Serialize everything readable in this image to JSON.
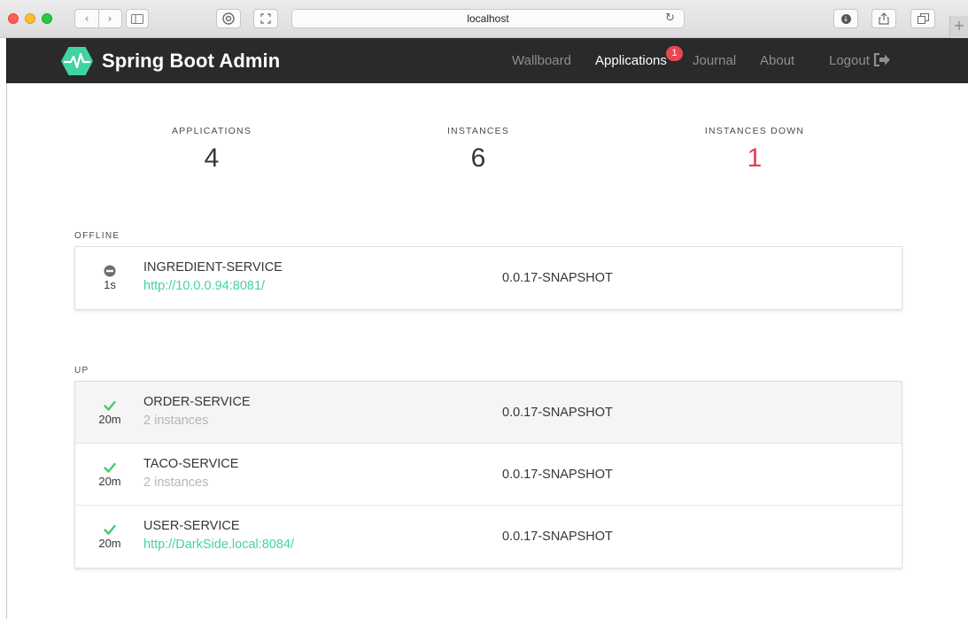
{
  "browser": {
    "url": "localhost",
    "back_icon": "chevron-left-icon",
    "forward_icon": "chevron-right-icon",
    "newtab_label": "+"
  },
  "navbar": {
    "brand": "Spring Boot Admin",
    "items": [
      {
        "label": "Wallboard",
        "active": false
      },
      {
        "label": "Applications",
        "active": true,
        "badge": "1"
      },
      {
        "label": "Journal",
        "active": false
      },
      {
        "label": "About",
        "active": false
      },
      {
        "label": "Logout",
        "active": false
      }
    ]
  },
  "stats": {
    "applications": {
      "label": "APPLICATIONS",
      "value": "4"
    },
    "instances": {
      "label": "INSTANCES",
      "value": "6"
    },
    "instances_down": {
      "label": "INSTANCES DOWN",
      "value": "1"
    }
  },
  "groups": {
    "offline": {
      "title": "OFFLINE",
      "apps": [
        {
          "status": "offline",
          "age": "1s",
          "name": "INGREDIENT-SERVICE",
          "sub": "http://10.0.0.94:8081/",
          "version": "0.0.17-SNAPSHOT"
        }
      ]
    },
    "up": {
      "title": "UP",
      "apps": [
        {
          "status": "up",
          "age": "20m",
          "name": "ORDER-SERVICE",
          "sub": "2 instances",
          "version": "0.0.17-SNAPSHOT"
        },
        {
          "status": "up",
          "age": "20m",
          "name": "TACO-SERVICE",
          "sub": "2 instances",
          "version": "0.0.17-SNAPSHOT"
        },
        {
          "status": "up",
          "age": "20m",
          "name": "USER-SERVICE",
          "sub": "http://DarkSide.local:8084/",
          "version": "0.0.17-SNAPSHOT"
        }
      ]
    }
  },
  "colors": {
    "navbar_bg": "#2a2a2a",
    "brand_green": "#42d3a5",
    "status_up": "#48c774",
    "status_down_count": "#e0405c",
    "badge": "#e8474f"
  }
}
